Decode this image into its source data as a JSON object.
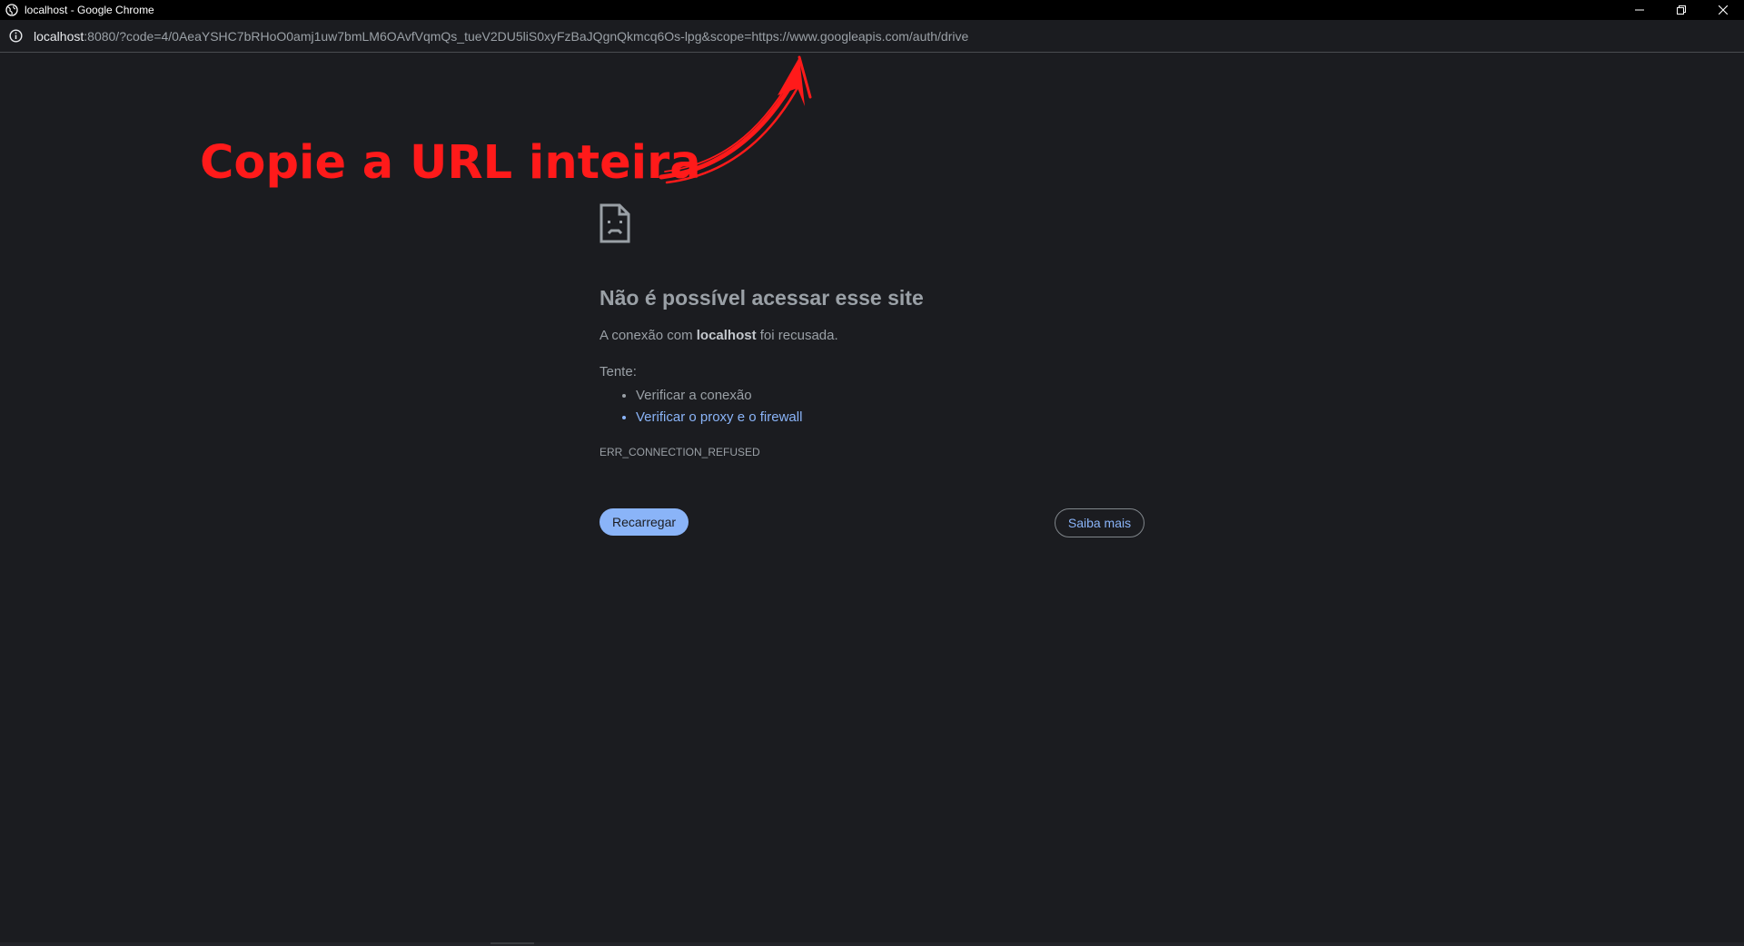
{
  "window": {
    "title": "localhost - Google Chrome"
  },
  "address_bar": {
    "url_host": "localhost",
    "url_rest": ":8080/?code=4/0AeaYSHC7bRHoO0amj1uw7bmLM6OAvfVqmQs_tueV2DU5liS0xyFzBaJQgnQkmcq6Os-lpg&scope=https://www.googleapis.com/auth/drive",
    "icon": "info-icon"
  },
  "annotation": {
    "text": "Copie a URL inteira",
    "color": "#ff1a1a"
  },
  "error_page": {
    "icon": "sad-page-icon",
    "heading": "Não é possível acessar esse site",
    "desc_before": "A conexão com ",
    "desc_host": "localhost",
    "desc_after": " foi recusada.",
    "try_label": "Tente:",
    "suggestions": [
      "Verificar a conexão",
      "Verificar o proxy e o firewall"
    ],
    "error_code": "ERR_CONNECTION_REFUSED",
    "reload_button": "Recarregar",
    "learn_more_button": "Saiba mais"
  },
  "colors": {
    "background": "#1b1c20",
    "link": "#8ab4f8",
    "text": "#9aa0a6"
  }
}
